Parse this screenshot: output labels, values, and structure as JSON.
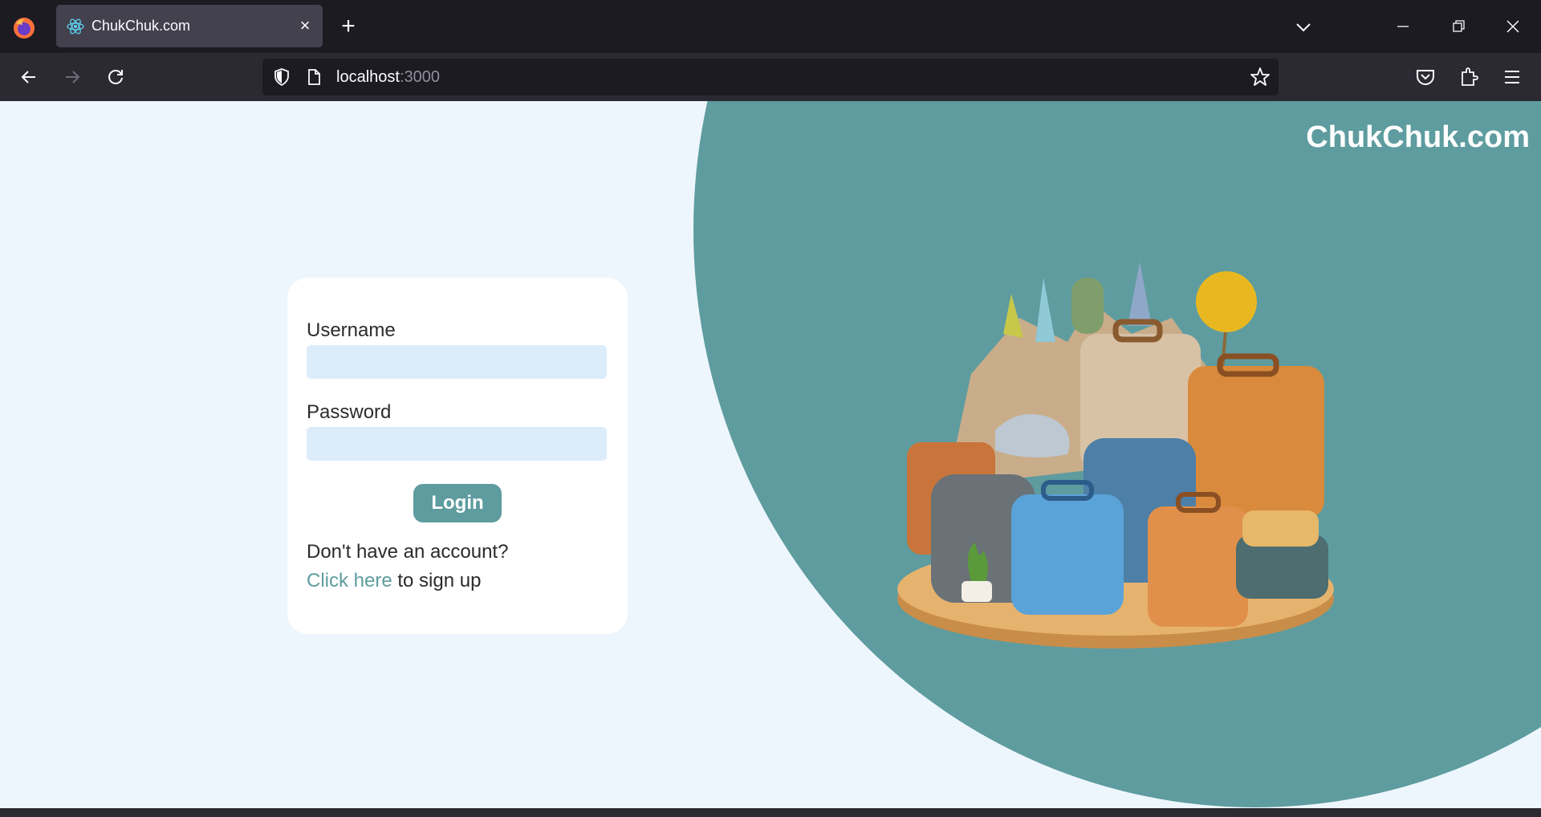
{
  "browser": {
    "tab_title": "ChukChuk.com",
    "url_host": "localhost",
    "url_port": ":3000"
  },
  "page": {
    "brand": "ChukChuk.com",
    "login": {
      "username_label": "Username",
      "username_value": "",
      "password_label": "Password",
      "password_value": "",
      "login_button": "Login",
      "no_account_text": "Don't have an account?",
      "signup_link_text": "Click here",
      "signup_suffix": " to sign up"
    }
  },
  "colors": {
    "accent": "#5e9c9f",
    "page_background": "#eef6fd",
    "input_background": "#dcecfb"
  }
}
